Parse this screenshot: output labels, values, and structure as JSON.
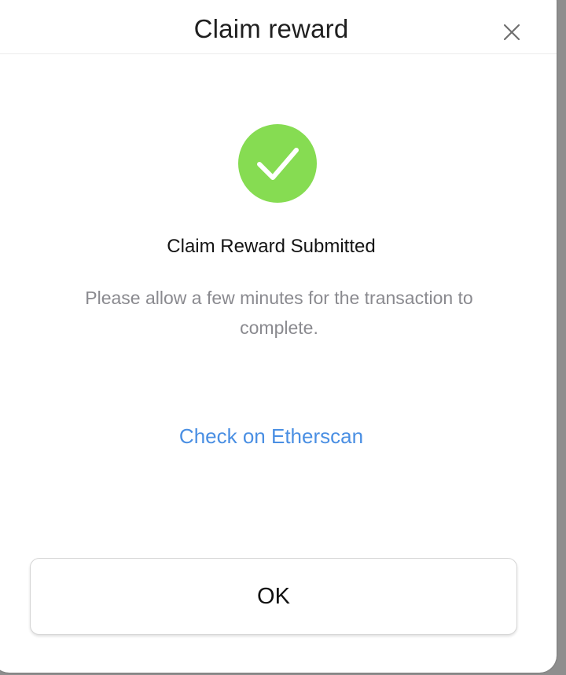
{
  "modal": {
    "title": "Claim reward",
    "close_icon": "close-icon",
    "status_icon": "check-circle-icon",
    "status_color": "#86dc52",
    "heading": "Claim Reward Submitted",
    "message": "Please allow a few minutes for the transaction to complete.",
    "link_label": "Check on Etherscan",
    "link_color": "#4a8fe3",
    "ok_label": "OK"
  }
}
